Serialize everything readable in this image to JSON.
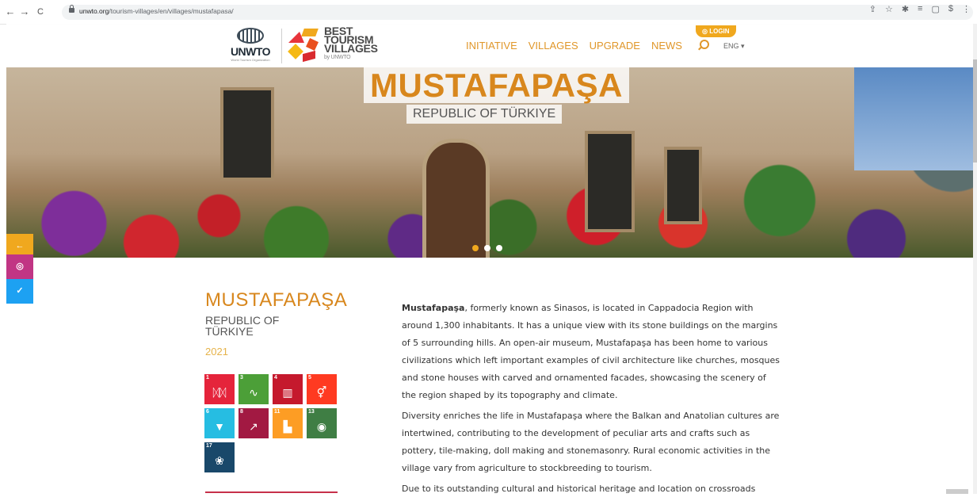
{
  "browser": {
    "url_domain": "unwto.org",
    "url_path": "/tourism-villages/en/villages/mustafapasa/",
    "back_icon": "←",
    "forward_icon": "→",
    "reload_icon": "C",
    "toolbar_icons": [
      "⇪",
      "☆",
      "✱",
      "≡",
      "▢",
      "$",
      "⋮"
    ]
  },
  "header": {
    "unwto_label": "UNWTO",
    "unwto_sub": "World Tourism Organization",
    "brand_line1": "BEST",
    "brand_line2": "TOURISM",
    "brand_line3": "VILLAGES",
    "brand_by": "by UNWTO",
    "menu": [
      "INITIATIVE",
      "VILLAGES",
      "UPGRADE",
      "NEWS"
    ],
    "login": "LOGIN",
    "language": "ENG ▾"
  },
  "hero": {
    "title": "MUSTAFAPAŞA",
    "subtitle": "REPUBLIC OF TÜRKIYE"
  },
  "social": {
    "arrow": "←",
    "instagram": "◎",
    "twitter": "✓"
  },
  "village": {
    "name": "MUSTAFAPAŞA",
    "country": "REPUBLIC OF TÜRKIYE",
    "year": "2021",
    "sdgs": [
      {
        "n": "1",
        "icon": "ᛞᛞ",
        "color": "#e5243b"
      },
      {
        "n": "3",
        "icon": "∿",
        "color": "#4c9f38"
      },
      {
        "n": "4",
        "icon": "▥",
        "color": "#c5192d"
      },
      {
        "n": "5",
        "icon": "⚥",
        "color": "#ff3a21"
      },
      {
        "n": "6",
        "icon": "▼",
        "color": "#26bde2"
      },
      {
        "n": "8",
        "icon": "↗",
        "color": "#a21942"
      },
      {
        "n": "11",
        "icon": "▙",
        "color": "#fd9d24"
      },
      {
        "n": "13",
        "icon": "◉",
        "color": "#3f7e44"
      },
      {
        "n": "17",
        "icon": "❀",
        "color": "#19486a"
      }
    ],
    "paragraph1_bold": "Mustafapaşa",
    "paragraph1": ", formerly known as Sinasos, is located in Cappadocia Region with around 1,300 inhabitants. It has a unique view with its stone buildings on the margins of 5 surrounding hills. An open-air museum, Mustafapaşa has been home to various civilizations which left important examples of civil architecture like churches, mosques and stone houses with carved and ornamented facades, showcasing the scenery of the region shaped by its topography and climate.",
    "paragraph2": "Diversity enriches the life in Mustafapaşa where the Balkan and Anatolian cultures are intertwined, contributing to the development of peculiar arts and crafts such as pottery, tile-making, doll making and stonemasonry. Rural economic activities in the village vary from agriculture to stockbreeding to tourism.",
    "paragraph3": "Due to its outstanding cultural and historical heritage and location on crossroads"
  }
}
